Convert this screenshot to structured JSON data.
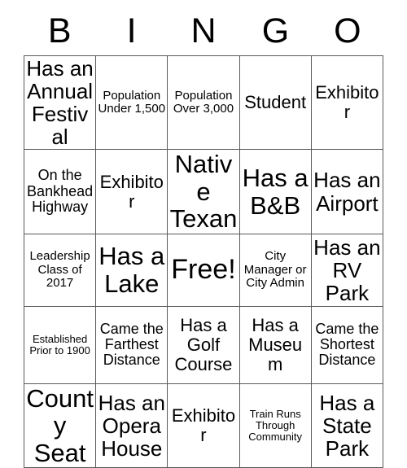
{
  "card": {
    "title_letters": [
      "B",
      "I",
      "N",
      "G",
      "O"
    ],
    "free_space": {
      "row": 2,
      "col": 2,
      "label": "Free!"
    },
    "grid_size": "5x5",
    "colors": {
      "background": "#ffffff",
      "text": "#000000",
      "border": "#5a5a5a"
    },
    "rows": [
      {
        "cells": [
          {
            "text": "Has an Annual Festival",
            "size": "fs-xl"
          },
          {
            "text": "Population Under 1,500",
            "size": "fs-s"
          },
          {
            "text": "Population Over 3,000",
            "size": "fs-s"
          },
          {
            "text": "Student",
            "size": "fs-l"
          },
          {
            "text": "Exhibitor",
            "size": "fs-l"
          }
        ]
      },
      {
        "cells": [
          {
            "text": "On the Bankhead Highway",
            "size": "fs-m"
          },
          {
            "text": "Exhibitor",
            "size": "fs-l"
          },
          {
            "text": "Native Texan",
            "size": "fs-xxl"
          },
          {
            "text": "Has a B&B",
            "size": "fs-xxl"
          },
          {
            "text": "Has an Airport",
            "size": "fs-xl"
          }
        ]
      },
      {
        "cells": [
          {
            "text": "Leadership Class of 2017",
            "size": "fs-s"
          },
          {
            "text": "Has a Lake",
            "size": "fs-xxl"
          },
          {
            "text": "Free!",
            "size": "fs-free"
          },
          {
            "text": "City Manager or City Admin",
            "size": "fs-s"
          },
          {
            "text": "Has an RV Park",
            "size": "fs-xl"
          }
        ]
      },
      {
        "cells": [
          {
            "text": "Established Prior to 1900",
            "size": "fs-xs"
          },
          {
            "text": "Came the Farthest Distance",
            "size": "fs-m"
          },
          {
            "text": "Has a Golf Course",
            "size": "fs-l"
          },
          {
            "text": "Has a Museum",
            "size": "fs-l"
          },
          {
            "text": "Came the Shortest Distance",
            "size": "fs-m"
          }
        ]
      },
      {
        "cells": [
          {
            "text": "County Seat",
            "size": "fs-xxl"
          },
          {
            "text": "Has an Opera House",
            "size": "fs-xl"
          },
          {
            "text": "Exhibitor",
            "size": "fs-l"
          },
          {
            "text": "Train Runs Through Community",
            "size": "fs-xs"
          },
          {
            "text": "Has a State Park",
            "size": "fs-xl"
          }
        ]
      }
    ]
  }
}
